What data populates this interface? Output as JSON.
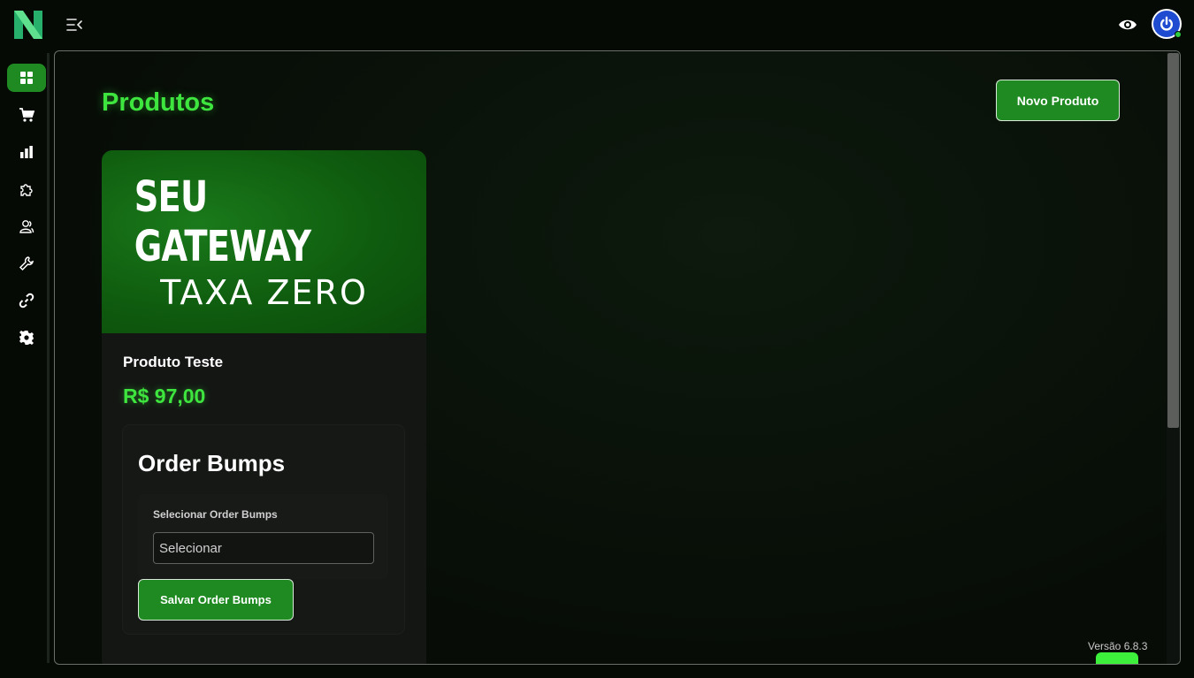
{
  "app": {
    "logo_icon": "brand-logo-icon",
    "menu_icon": "collapse-menu-icon",
    "visibility_icon": "eye-icon",
    "avatar_icon": "power-icon",
    "status": "online",
    "colors": {
      "accent": "#1f8a22",
      "title_green": "#3ee53e",
      "avatar_blue": "#1f4bd1",
      "background": "#050a05"
    }
  },
  "sidebar": {
    "items": [
      {
        "icon": "dashboard-grid-icon",
        "active": true
      },
      {
        "icon": "cart-icon",
        "active": false
      },
      {
        "icon": "bar-chart-icon",
        "active": false
      },
      {
        "icon": "puzzle-icon",
        "active": false
      },
      {
        "icon": "users-icon",
        "active": false
      },
      {
        "icon": "wrench-icon",
        "active": false
      },
      {
        "icon": "link-icon",
        "active": false
      },
      {
        "icon": "gear-icon",
        "active": false
      }
    ]
  },
  "page": {
    "title": "Produtos",
    "new_product_label": "Novo Produto",
    "version": "Versão 6.8.3"
  },
  "product": {
    "banner_line1": "SEU GATEWAY",
    "banner_line2": "TAXA ZERO",
    "name": "Produto Teste",
    "price": "R$ 97,00",
    "order_bumps": {
      "title": "Order Bumps",
      "select_label": "Selecionar Order Bumps",
      "select_value": "Selecionar",
      "save_label": "Salvar Order Bumps"
    }
  }
}
